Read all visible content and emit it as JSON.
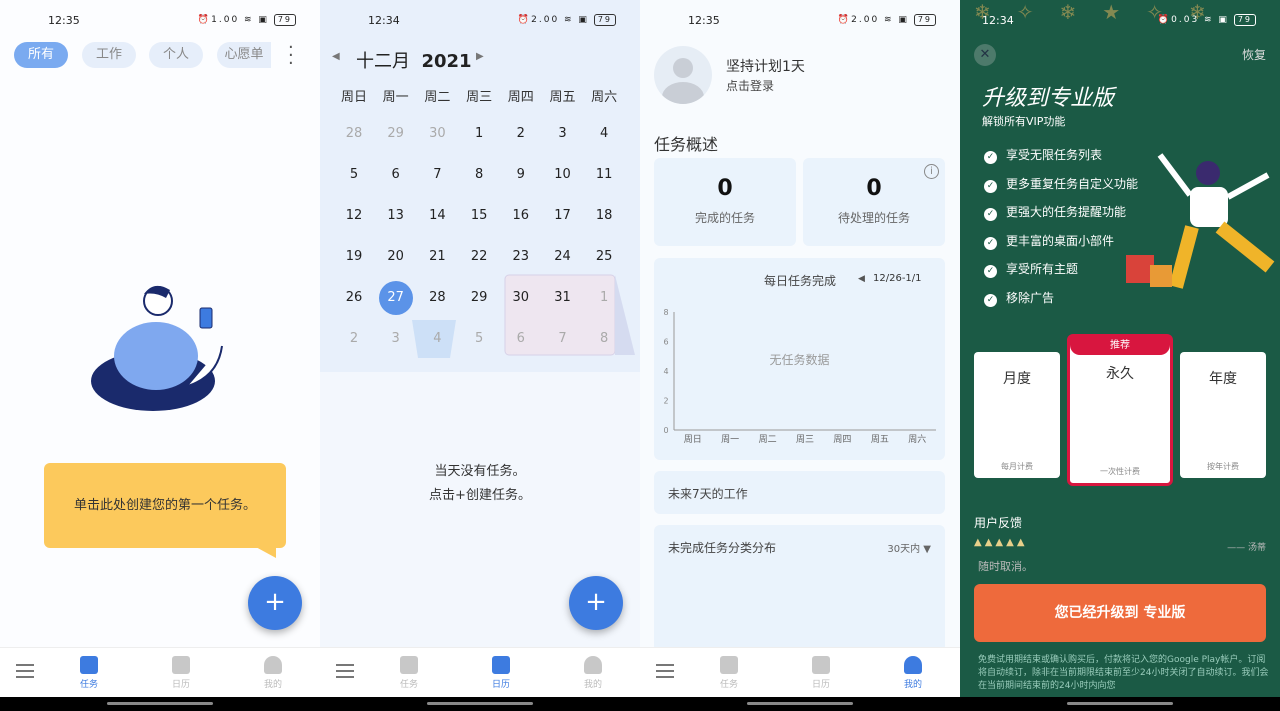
{
  "screen1": {
    "status": {
      "time": "12:35",
      "speed": "1.00",
      "battery": "79"
    },
    "chips": [
      {
        "label": "所有",
        "active": true
      },
      {
        "label": "工作"
      },
      {
        "label": "个人"
      },
      {
        "label": "心愿单"
      }
    ],
    "tooltip": "单击此处创建您的第一个任务。",
    "fab": "+",
    "nav": [
      {
        "label": "任务",
        "active": true
      },
      {
        "label": "日历"
      },
      {
        "label": "我的"
      }
    ]
  },
  "screen2": {
    "status": {
      "time": "12:34",
      "speed": "2.00",
      "battery": "79"
    },
    "month": "十二月",
    "year": "2021",
    "weekdays": [
      "周日",
      "周一",
      "周二",
      "周三",
      "周四",
      "周五",
      "周六"
    ],
    "days": [
      "28",
      "29",
      "30",
      "1",
      "2",
      "3",
      "4",
      "5",
      "6",
      "7",
      "8",
      "9",
      "10",
      "11",
      "12",
      "13",
      "14",
      "15",
      "16",
      "17",
      "18",
      "19",
      "20",
      "21",
      "22",
      "23",
      "24",
      "25",
      "26",
      "27",
      "28",
      "29",
      "30",
      "31",
      "1",
      "2",
      "3",
      "4",
      "5",
      "6",
      "7",
      "8"
    ],
    "selected_day": "27",
    "empty_line1": "当天没有任务。",
    "empty_line2": "点击+创建任务。",
    "fab": "+",
    "nav": [
      {
        "label": "任务"
      },
      {
        "label": "日历",
        "active": true
      },
      {
        "label": "我的"
      }
    ]
  },
  "screen3": {
    "status": {
      "time": "12:35",
      "speed": "2.00",
      "battery": "79"
    },
    "profile_title": "坚持计划1天",
    "profile_login": "点击登录",
    "overview_title": "任务概述",
    "completed_count": "0",
    "completed_label": "完成的任务",
    "pending_count": "0",
    "pending_label": "待处理的任务",
    "chart_data": {
      "type": "bar",
      "title": "每日任务完成",
      "range": "12/26-1/1",
      "categories": [
        "周日",
        "周一",
        "周二",
        "周三",
        "周四",
        "周五",
        "周六"
      ],
      "values": [
        0,
        0,
        0,
        0,
        0,
        0,
        0
      ],
      "yticks": [
        "0",
        "2",
        "4",
        "6",
        "8"
      ],
      "ylim": [
        0,
        8
      ],
      "empty_text": "无任务数据"
    },
    "next7_title": "未来7天的工作",
    "dist_title": "未完成任务分类分布",
    "dist_range": "30天内",
    "nav": [
      {
        "label": "任务"
      },
      {
        "label": "日历"
      },
      {
        "label": "我的",
        "active": true
      }
    ]
  },
  "screen4": {
    "status": {
      "time": "12:34",
      "speed": "0.03",
      "battery": "79"
    },
    "restore": "恢复",
    "title": "升级到专业版",
    "subtitle": "解锁所有VIP功能",
    "features": [
      "享受无限任务列表",
      "更多重复任务自定义功能",
      "更强大的任务提醒功能",
      "更丰富的桌面小部件",
      "享受所有主题",
      "移除广告"
    ],
    "plans": [
      {
        "title": "月度",
        "sub": "每月计费"
      },
      {
        "title": "永久",
        "sub": "一次性计费",
        "badge": "推荐"
      },
      {
        "title": "年度",
        "sub": "按年计费"
      }
    ],
    "feedback_title": "用户反馈",
    "rating": 5,
    "reviewer": "—— 汤蒂",
    "cancel_note": "随时取消。",
    "upgrade_button": "您已经升级到 专业版",
    "legal": "免费试用期结束或确认购买后，付款将记入您的Google Play帐户。订阅将自动续订，除非在当前期限结束前至少24小时关闭了自动续订。我们会在当前期间结束前的24小时内向您",
    "colors": {
      "bg": "#1b5a45",
      "accent": "#ee6a3c",
      "badge": "#d8163f"
    }
  }
}
